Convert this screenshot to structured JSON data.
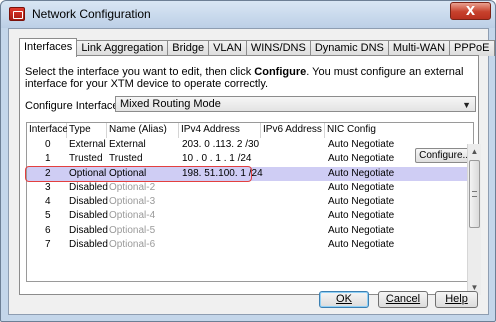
{
  "window": {
    "title": "Network Configuration",
    "close_glyph": "X",
    "accent": "#c7412c"
  },
  "tabs": [
    {
      "label": "Interfaces",
      "active": true
    },
    {
      "label": "Link Aggregation",
      "active": false
    },
    {
      "label": "Bridge",
      "active": false
    },
    {
      "label": "VLAN",
      "active": false
    },
    {
      "label": "WINS/DNS",
      "active": false
    },
    {
      "label": "Dynamic DNS",
      "active": false
    },
    {
      "label": "Multi-WAN",
      "active": false
    },
    {
      "label": "PPPoE",
      "active": false
    }
  ],
  "instructions": {
    "part1": "Select the interface you want to edit, then click ",
    "bold": "Configure",
    "part2": ". You must configure an external interface for your XTM device to operate correctly."
  },
  "configure_interfaces": {
    "label": "Configure Interfaces in",
    "selected": "Mixed Routing Mode"
  },
  "table": {
    "headers": [
      "Interface",
      "Type",
      "Name (Alias)",
      "IPv4 Address",
      "IPv6 Address",
      "NIC Config"
    ],
    "rows": [
      {
        "interface": "0",
        "type": "External",
        "name": "External",
        "ipv4": "203. 0 .113. 2 /30",
        "ipv6": "",
        "nic": "Auto Negotiate",
        "selected": false,
        "disabled": false
      },
      {
        "interface": "1",
        "type": "Trusted",
        "name": "Trusted",
        "ipv4": "10 . 0 . 1 . 1 /24",
        "ipv6": "",
        "nic": "Auto Negotiate",
        "selected": false,
        "disabled": false
      },
      {
        "interface": "2",
        "type": "Optional",
        "name": "Optional",
        "ipv4": "198. 51.100. 1 /24",
        "ipv6": "",
        "nic": "Auto Negotiate",
        "selected": true,
        "disabled": false
      },
      {
        "interface": "3",
        "type": "Disabled",
        "name": "Optional-2",
        "ipv4": "",
        "ipv6": "",
        "nic": "Auto Negotiate",
        "selected": false,
        "disabled": true
      },
      {
        "interface": "4",
        "type": "Disabled",
        "name": "Optional-3",
        "ipv4": "",
        "ipv6": "",
        "nic": "Auto Negotiate",
        "selected": false,
        "disabled": true
      },
      {
        "interface": "5",
        "type": "Disabled",
        "name": "Optional-4",
        "ipv4": "",
        "ipv6": "",
        "nic": "Auto Negotiate",
        "selected": false,
        "disabled": true
      },
      {
        "interface": "6",
        "type": "Disabled",
        "name": "Optional-5",
        "ipv4": "",
        "ipv6": "",
        "nic": "Auto Negotiate",
        "selected": false,
        "disabled": true
      },
      {
        "interface": "7",
        "type": "Disabled",
        "name": "Optional-6",
        "ipv4": "",
        "ipv6": "",
        "nic": "Auto Negotiate",
        "selected": false,
        "disabled": true
      }
    ],
    "selection_color": "#cfcdf4",
    "highlight_color": "#e34040"
  },
  "buttons": {
    "configure": "Configure...",
    "ok": "OK",
    "cancel": "Cancel",
    "help": "Help"
  }
}
